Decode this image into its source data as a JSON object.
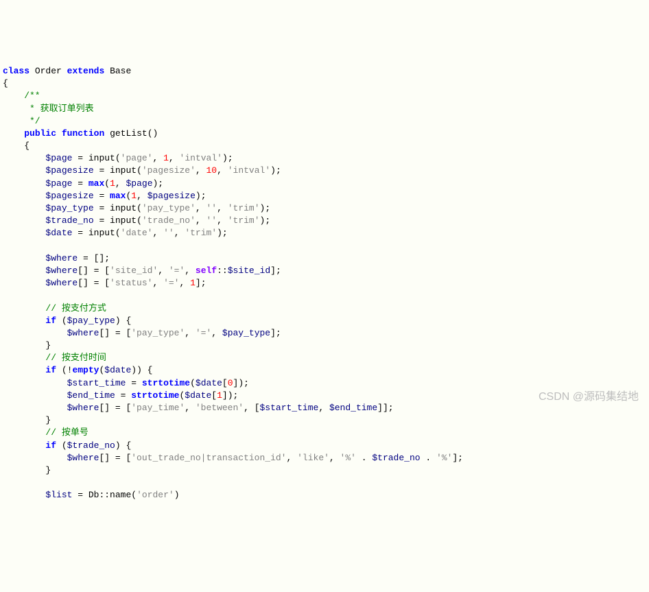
{
  "code": {
    "line1": {
      "kw1": "class",
      "name1": "Order",
      "kw2": "extends",
      "name2": "Base"
    },
    "line2": "{",
    "line3": "    /**",
    "line4": "     * 获取订单列表",
    "line5": "     */",
    "line6": {
      "kw1": "public",
      "kw2": "function",
      "fn": "getList",
      "rest": "()"
    },
    "line7": "    {",
    "line8": {
      "v1": "$page",
      "eq": " = ",
      "fn": "input",
      "p1": "'page'",
      "c1": ", ",
      "n1": "1",
      "c2": ", ",
      "p2": "'intval'",
      "end": ");"
    },
    "line9": {
      "v1": "$pagesize",
      "eq": " = ",
      "fn": "input",
      "p1": "'pagesize'",
      "c1": ", ",
      "n1": "10",
      "c2": ", ",
      "p2": "'intval'",
      "end": ");"
    },
    "line10": {
      "v1": "$page",
      "eq": " = ",
      "fn": "max",
      "n1": "1",
      "c1": ", ",
      "v2": "$page",
      "end": ");"
    },
    "line11": {
      "v1": "$pagesize",
      "eq": " = ",
      "fn": "max",
      "n1": "1",
      "c1": ", ",
      "v2": "$pagesize",
      "end": ");"
    },
    "line12": {
      "v1": "$pay_type",
      "eq": " = ",
      "fn": "input",
      "p1": "'pay_type'",
      "c1": ", ",
      "p2": "''",
      "c2": ", ",
      "p3": "'trim'",
      "end": ");"
    },
    "line13": {
      "v1": "$trade_no",
      "eq": " = ",
      "fn": "input",
      "p1": "'trade_no'",
      "c1": ", ",
      "p2": "''",
      "c2": ", ",
      "p3": "'trim'",
      "end": ");"
    },
    "line14": {
      "v1": "$date",
      "eq": " = ",
      "fn": "input",
      "p1": "'date'",
      "c1": ", ",
      "p2": "''",
      "c2": ", ",
      "p3": "'trim'",
      "end": ");"
    },
    "line16": {
      "v1": "$where",
      "rest": " = [];"
    },
    "line17": {
      "v1": "$where",
      "br": "[] = [",
      "p1": "'site_id'",
      "c1": ", ",
      "p2": "'='",
      "c2": ", ",
      "self": "self",
      "scope": "::",
      "v2": "$site_id",
      "end": "];"
    },
    "line18": {
      "v1": "$where",
      "br": "[] = [",
      "p1": "'status'",
      "c1": ", ",
      "p2": "'='",
      "c2": ", ",
      "n1": "1",
      "end": "];"
    },
    "line20": "        // 按支付方式",
    "line21": {
      "kw": "if",
      "o": " (",
      "v1": "$pay_type",
      "end": ") {"
    },
    "line22": {
      "v1": "$where",
      "br": "[] = [",
      "p1": "'pay_type'",
      "c1": ", ",
      "p2": "'='",
      "c2": ", ",
      "v2": "$pay_type",
      "end": "];"
    },
    "line23": "        }",
    "line24": "        // 按支付时间",
    "line25": {
      "kw": "if",
      "o": " (!",
      "fn": "empty",
      "op": "(",
      "v1": "$date",
      "end": ")) {"
    },
    "line26": {
      "v1": "$start_time",
      "eq": " = ",
      "fn": "strtotime",
      "op": "(",
      "v2": "$date",
      "br": "[",
      "n1": "0",
      "end": "]);"
    },
    "line27": {
      "v1": "$end_time",
      "eq": " = ",
      "fn": "strtotime",
      "op": "(",
      "v2": "$date",
      "br": "[",
      "n1": "1",
      "end": "]);"
    },
    "line28": {
      "v1": "$where",
      "br": "[] = [",
      "p1": "'pay_time'",
      "c1": ", ",
      "p2": "'between'",
      "c2": ", [",
      "v2": "$start_time",
      "c3": ", ",
      "v3": "$end_time",
      "end": "]];"
    },
    "line29": "        }",
    "line30": "        // 按单号",
    "line31": {
      "kw": "if",
      "o": " (",
      "v1": "$trade_no",
      "end": ") {"
    },
    "line32": {
      "v1": "$where",
      "br": "[] = [",
      "p1": "'out_trade_no|transaction_id'",
      "c1": ", ",
      "p2": "'like'",
      "c2": ", ",
      "p3": "'%'",
      "dot1": " . ",
      "v2": "$trade_no",
      "dot2": " . ",
      "p4": "'%'",
      "end": "];"
    },
    "line33": "        }",
    "line35": {
      "v1": "$list",
      "eq": " = Db::",
      "fn": "name",
      "op": "(",
      "p1": "'order'",
      "end": ")"
    }
  },
  "watermark": "CSDN @源码集结地"
}
